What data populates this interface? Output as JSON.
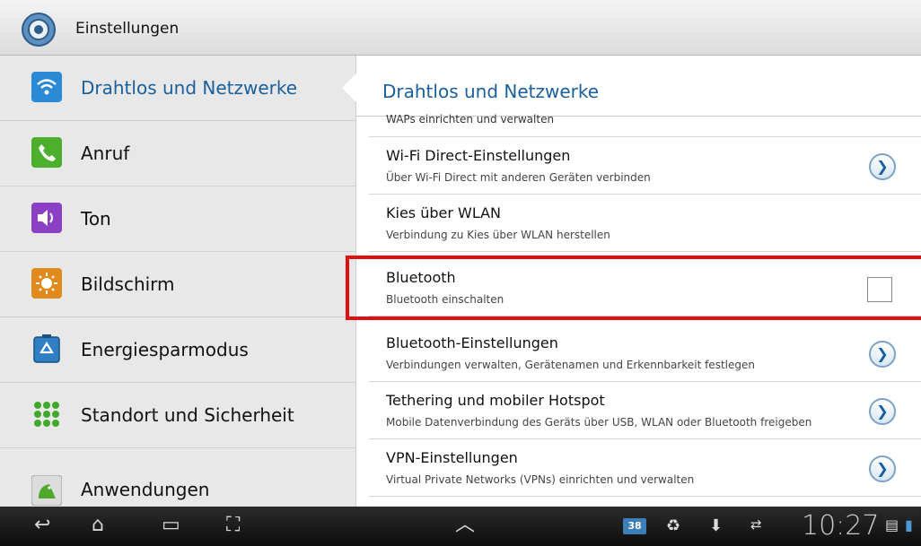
{
  "app": {
    "title": "Einstellungen",
    "icon": "settings-gear-icon"
  },
  "sidebar": {
    "items": [
      {
        "label": "Drahtlos und Netzwerke",
        "icon": "wifi-icon",
        "active": true
      },
      {
        "label": "Anruf",
        "icon": "phone-icon"
      },
      {
        "label": "Ton",
        "icon": "speaker-icon"
      },
      {
        "label": "Bildschirm",
        "icon": "brightness-icon"
      },
      {
        "label": "Energiesparmodus",
        "icon": "recycle-battery-icon"
      },
      {
        "label": "Standort und Sicherheit",
        "icon": "grid-dots-icon"
      },
      {
        "label": "Anwendungen",
        "icon": "android-icon"
      }
    ]
  },
  "content": {
    "title": "Drahtlos und Netzwerke",
    "rows": [
      {
        "title": "WAPs einrichten und verwalten",
        "subtitle": "",
        "control": "chevron"
      },
      {
        "title": "Wi-Fi Direct-Einstellungen",
        "subtitle": "Über Wi-Fi Direct mit anderen Geräten verbinden",
        "control": "chevron"
      },
      {
        "title": "Kies über WLAN",
        "subtitle": "Verbindung zu Kies über WLAN herstellen",
        "control": "none"
      },
      {
        "title": "Bluetooth",
        "subtitle": "Bluetooth einschalten",
        "control": "checkbox",
        "checked": false
      },
      {
        "title": "Bluetooth-Einstellungen",
        "subtitle": "Verbindungen verwalten, Gerätenamen und Erkennbarkeit festlegen",
        "control": "chevron"
      },
      {
        "title": "Tethering und mobiler Hotspot",
        "subtitle": "Mobile Datenverbindung des Geräts über USB, WLAN oder Bluetooth freigeben",
        "control": "chevron"
      },
      {
        "title": "VPN-Einstellungen",
        "subtitle": "Virtual Private Networks (VPNs) einrichten und verwalten",
        "control": "chevron"
      }
    ]
  },
  "statusbar": {
    "time": "10:27",
    "calendar_badge": "38",
    "icons": [
      "calendar-icon",
      "recycle-icon",
      "download-icon",
      "sync-icon",
      "battery-icon"
    ]
  },
  "colors": {
    "accent": "#1a5f9c",
    "highlight": "#e01010"
  }
}
